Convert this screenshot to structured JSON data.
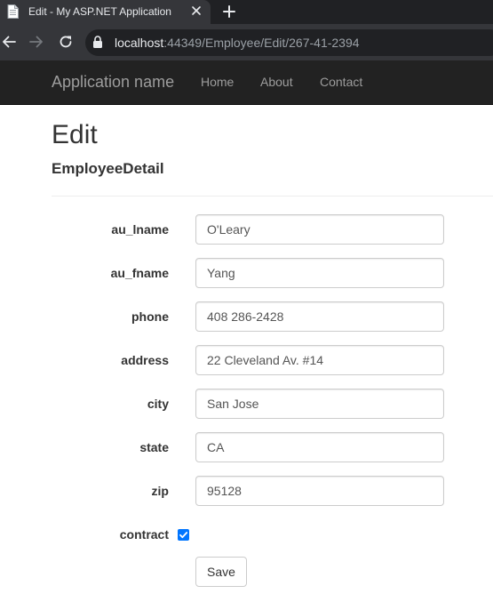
{
  "browser": {
    "tab_title": "Edit - My ASP.NET Application",
    "url_host": "localhost",
    "url_rest": ":44349/Employee/Edit/267-41-2394",
    "icons": [
      "page-favicon-icon",
      "close-icon",
      "plus-icon",
      "back-arrow-icon",
      "forward-arrow-icon",
      "reload-icon",
      "lock-icon"
    ]
  },
  "navbar": {
    "brand": "Application name",
    "links": [
      {
        "label": "Home"
      },
      {
        "label": "About"
      },
      {
        "label": "Contact"
      }
    ]
  },
  "page": {
    "heading": "Edit",
    "subheading": "EmployeeDetail"
  },
  "form": {
    "fields": [
      {
        "label": "au_lname",
        "value": "O'Leary"
      },
      {
        "label": "au_fname",
        "value": "Yang"
      },
      {
        "label": "phone",
        "value": "408 286-2428"
      },
      {
        "label": "address",
        "value": "22 Cleveland Av. #14"
      },
      {
        "label": "city",
        "value": "San Jose"
      },
      {
        "label": "state",
        "value": "CA"
      },
      {
        "label": "zip",
        "value": "95128"
      }
    ],
    "contract": {
      "label": "contract",
      "checked": true
    },
    "save_label": "Save"
  },
  "colors": {
    "navbar_bg": "#222222",
    "navbar_text": "#9d9d9d",
    "checkbox_accent": "#0075ff",
    "browser_tab": "#35363a",
    "browser_frame": "#202124"
  }
}
